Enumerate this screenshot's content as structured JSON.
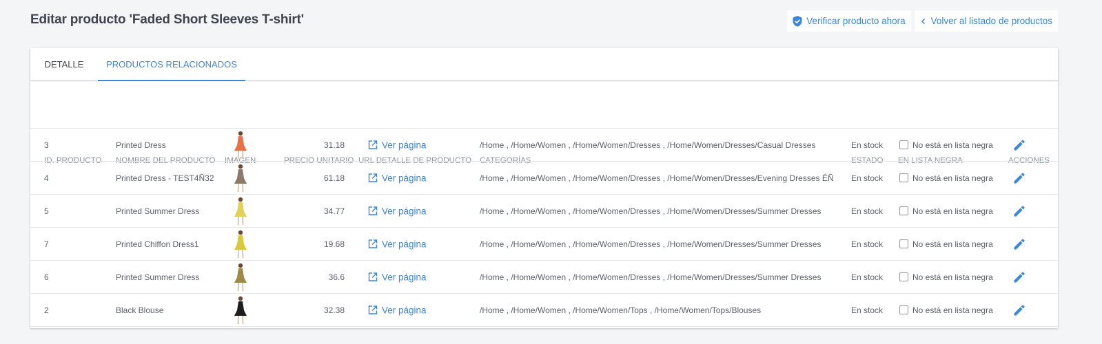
{
  "header": {
    "title": "Editar producto 'Faded Short Sleeves T-shirt'",
    "verify_label": "Verificar producto ahora",
    "back_label": "Volver al listado de productos"
  },
  "tabs": [
    {
      "label": "DETALLE",
      "active": false
    },
    {
      "label": "PRODUCTOS RELACIONADOS",
      "active": true
    }
  ],
  "table": {
    "columns": [
      "ID. PRODUCTO",
      "NOMBRE DEL PRODUCTO",
      "IMAGEN",
      "PRECIO UNITARIO",
      "URL DETALLE DE PRODUCTO",
      "CATEGORÍAS",
      "ESTADO",
      "EN LISTA NEGRA",
      "ACCIONES"
    ],
    "rows": [
      {
        "id": "3",
        "name": "Printed Dress",
        "price": "31.18",
        "link": "Ver página",
        "categories": "/Home , /Home/Women , /Home/Women/Dresses , /Home/Women/Dresses/Casual Dresses",
        "status": "En stock",
        "blacklist": "No está en lista negra",
        "img_color": "#e8714a"
      },
      {
        "id": "4",
        "name": "Printed Dress - TEST4Ñ32",
        "price": "61.18",
        "link": "Ver página",
        "categories": "/Home , /Home/Women , /Home/Women/Dresses , /Home/Women/Dresses/Evening Dresses ÉÑ",
        "status": "En stock",
        "blacklist": "No está en lista negra",
        "img_color": "#8a7a6a"
      },
      {
        "id": "5",
        "name": "Printed Summer Dress",
        "price": "34.77",
        "link": "Ver página",
        "categories": "/Home , /Home/Women , /Home/Women/Dresses , /Home/Women/Dresses/Summer Dresses",
        "status": "En stock",
        "blacklist": "No está en lista negra",
        "img_color": "#e3d05a"
      },
      {
        "id": "7",
        "name": "Printed Chiffon Dress1",
        "price": "19.68",
        "link": "Ver página",
        "categories": "/Home , /Home/Women , /Home/Women/Dresses , /Home/Women/Dresses/Summer Dresses",
        "status": "En stock",
        "blacklist": "No está en lista negra",
        "img_color": "#d8c93c"
      },
      {
        "id": "6",
        "name": "Printed Summer Dress",
        "price": "36.6",
        "link": "Ver página",
        "categories": "/Home , /Home/Women , /Home/Women/Dresses , /Home/Women/Dresses/Summer Dresses",
        "status": "En stock",
        "blacklist": "No está en lista negra",
        "img_color": "#a08a4a"
      },
      {
        "id": "2",
        "name": "Black Blouse",
        "price": "32.38",
        "link": "Ver página",
        "categories": "/Home , /Home/Women , /Home/Women/Tops , /Home/Women/Tops/Blouses",
        "status": "En stock",
        "blacklist": "No está en lista negra",
        "img_color": "#1e1e1e"
      }
    ]
  },
  "colors": {
    "accent": "#3a86d9",
    "title": "#3e454f",
    "background": "#f4f5f7"
  },
  "icons": {
    "verify": "shield-check-icon",
    "back": "chevron-left-icon",
    "link": "external-link-icon",
    "edit": "pencil-icon"
  }
}
